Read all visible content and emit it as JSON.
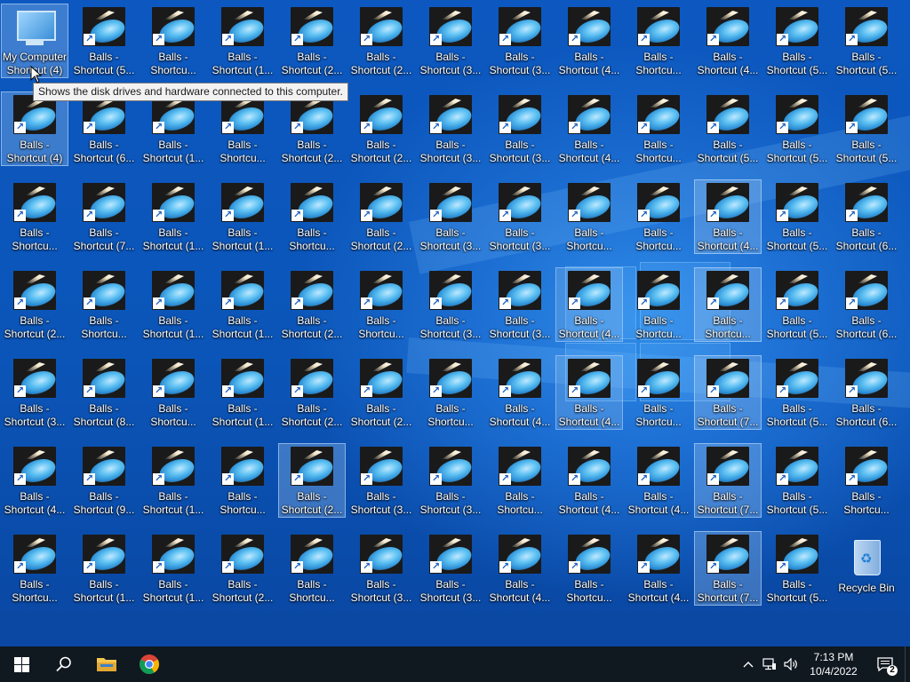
{
  "desktop": {
    "this_pc": {
      "label_line1": "My Computer",
      "label_line2": "Shortcut (4)",
      "icon": "computer-icon"
    },
    "tooltip": "Shows the disk drives and hardware connected to this computer.",
    "recycle_bin": {
      "label": "Recycle Bin",
      "icon": "recycle-bin-icon"
    },
    "shortcut_line1": "Balls -",
    "shortcut_icon": "balls-app-icon",
    "rows": [
      [
        "Shortcut (5...",
        "Shortcu...",
        "Shortcut (1...",
        "Shortcut (2...",
        "Shortcut (2...",
        "Shortcut (3...",
        "Shortcut (3...",
        "Shortcut (4...",
        "Shortcu...",
        "Shortcut (4...",
        "Shortcut (5...",
        "Shortcut (5..."
      ],
      [
        "Shortcut (4)",
        "Shortcut (6...",
        "Shortcut (1...",
        "Shortcu...",
        "Shortcut (2...",
        "Shortcut (2...",
        "Shortcut (3...",
        "Shortcut (3...",
        "Shortcut (4...",
        "Shortcu...",
        "Shortcut (5...",
        "Shortcut (5...",
        "Shortcut (5..."
      ],
      [
        "Shortcu...",
        "Shortcut (7...",
        "Shortcut (1...",
        "Shortcut (1...",
        "Shortcu...",
        "Shortcut (2...",
        "Shortcut (3...",
        "Shortcut (3...",
        "Shortcu...",
        "Shortcu...",
        "Shortcut (4...",
        "Shortcut (5...",
        "Shortcut (6..."
      ],
      [
        "Shortcut (2...",
        "Shortcu...",
        "Shortcut (1...",
        "Shortcut (1...",
        "Shortcut (2...",
        "Shortcu...",
        "Shortcut (3...",
        "Shortcut (3...",
        "Shortcut (4...",
        "Shortcu...",
        "Shortcu...",
        "Shortcut (5...",
        "Shortcut (6..."
      ],
      [
        "Shortcut (3...",
        "Shortcut (8...",
        "Shortcu...",
        "Shortcut (1...",
        "Shortcut (2...",
        "Shortcut (2...",
        "Shortcu...",
        "Shortcut (4...",
        "Shortcut (4...",
        "Shortcu...",
        "Shortcut (7...",
        "Shortcut (5...",
        "Shortcut (6..."
      ],
      [
        "Shortcut (4...",
        "Shortcut (9...",
        "Shortcut (1...",
        "Shortcu...",
        "Shortcut (2...",
        "Shortcut (3...",
        "Shortcut (3...",
        "Shortcu...",
        "Shortcut (4...",
        "Shortcut (4...",
        "Shortcut (7...",
        "Shortcut (5...",
        "Shortcu..."
      ],
      [
        "Shortcu...",
        "Shortcut (1...",
        "Shortcut (1...",
        "Shortcut (2...",
        "Shortcu...",
        "Shortcut (3...",
        "Shortcut (3...",
        "Shortcut (4...",
        "Shortcu...",
        "Shortcut (4...",
        "Shortcut (7...",
        "Shortcut (5..."
      ]
    ]
  },
  "taskbar": {
    "start_icon": "windows-logo-icon",
    "search_icon": "search-icon",
    "pinned": [
      {
        "name": "file-explorer",
        "icon": "folder-icon"
      },
      {
        "name": "chrome",
        "icon": "chrome-icon"
      }
    ],
    "clock_time": "7:13 PM",
    "clock_date": "10/4/2022",
    "notification_count": "2",
    "accent": "#0078d7"
  }
}
